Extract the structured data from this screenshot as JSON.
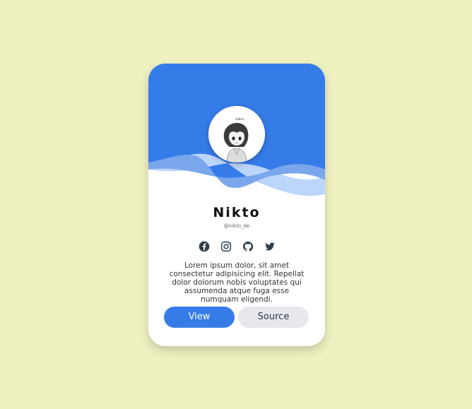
{
  "card": {
    "name": "Nikto",
    "handle": "@nikto_de",
    "bio": "Lorem ipsum dolor, sit amet consectetur adipisicing elit. Repellat dolor dolorum nobis voluptates qui assumenda atque fuga esse numquam eligendi.",
    "avatar_caption": "nikto",
    "colors": {
      "accent": "#367ce9",
      "wave_mid": "#7aa6ec",
      "wave_light": "#bcd5fb",
      "icon": "#2d3e4a",
      "background": "#f0f1c1"
    },
    "socials": [
      {
        "icon": "facebook-icon"
      },
      {
        "icon": "instagram-icon"
      },
      {
        "icon": "github-icon"
      },
      {
        "icon": "twitter-icon"
      }
    ],
    "buttons": {
      "view_label": "View",
      "source_label": "Source"
    }
  }
}
